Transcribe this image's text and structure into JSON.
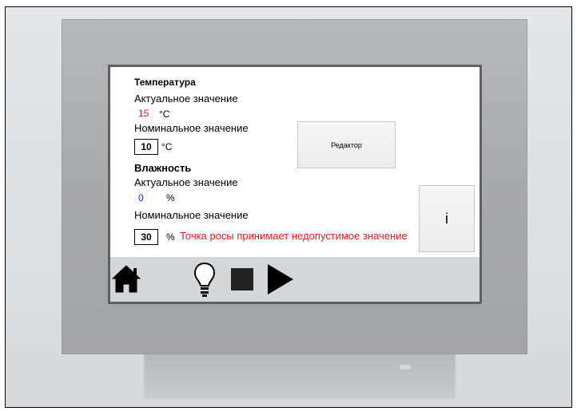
{
  "temperature": {
    "title": "Температура",
    "actual_label": "Актуальное значение",
    "actual_value": "15",
    "actual_unit": "°C",
    "nominal_label": "Номинальное значение",
    "nominal_value": "10",
    "nominal_unit": "°C"
  },
  "editor_button": {
    "label": "Редактор"
  },
  "humidity": {
    "title": "Влажность",
    "actual_label": "Актуальное значение",
    "actual_value": "0",
    "actual_unit": "%",
    "nominal_label": "Номинальное значение",
    "nominal_value": "30",
    "nominal_unit": "%"
  },
  "warning": {
    "text": "Точка росы принимает недопустимое значение"
  },
  "info_button": {
    "label": "i"
  },
  "toolbar": {
    "icons": [
      "home-icon",
      "lightbulb-icon",
      "stop-icon",
      "play-icon"
    ]
  },
  "colors": {
    "actual_temp": "#e02020",
    "actual_humidity": "#2030c8",
    "warning": "#e02020"
  }
}
